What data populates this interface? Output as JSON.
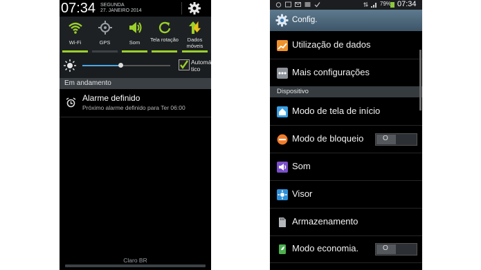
{
  "notification_panel": {
    "clock": "07:34",
    "day": "SEGUNDA",
    "date": "27. JANEIRO 2014",
    "quick_settings": [
      {
        "label": "Wi-Fi",
        "icon": "wifi-icon",
        "active": true
      },
      {
        "label": "GPS",
        "icon": "gps-icon",
        "active": false
      },
      {
        "label": "Som",
        "icon": "sound-icon",
        "active": true
      },
      {
        "label": "Tela rotação",
        "icon": "rotation-icon",
        "active": true
      },
      {
        "label": "Dados móveis",
        "icon": "mobile-data-icon",
        "active": true
      }
    ],
    "brightness": {
      "level": 0.44,
      "auto_label": "Automático",
      "auto_checked": true
    },
    "ongoing_header": "Em andamento",
    "notification": {
      "title": "Alarme definido",
      "detail": "Próximo alarme definido para Ter 06:00"
    },
    "carrier": "Claro BR"
  },
  "settings": {
    "status_bar": {
      "battery_pct": "79%",
      "time": "07:34"
    },
    "title": "Config.",
    "items_top": [
      {
        "label": "Utilização de dados",
        "icon": "data-usage-icon"
      },
      {
        "label": "Mais configurações",
        "icon": "more-settings-icon"
      }
    ],
    "section_label": "Dispositivo",
    "device_items": [
      {
        "label": "Modo de tela de início",
        "icon": "home-screen-icon",
        "toggle": false
      },
      {
        "label": "Modo de bloqueio",
        "icon": "block-mode-icon",
        "toggle": true,
        "toggle_text": "O"
      },
      {
        "label": "Som",
        "icon": "sound-icon",
        "toggle": false
      },
      {
        "label": "Visor",
        "icon": "display-icon",
        "toggle": false
      },
      {
        "label": "Armazenamento",
        "icon": "storage-icon",
        "toggle": false
      },
      {
        "label": "Modo economia.",
        "icon": "power-saving-icon",
        "toggle": true,
        "toggle_text": "O"
      }
    ]
  },
  "colors": {
    "accent_green": "#9bd02a",
    "action_bar": "#4e6678",
    "section_bg": "#363b40"
  }
}
